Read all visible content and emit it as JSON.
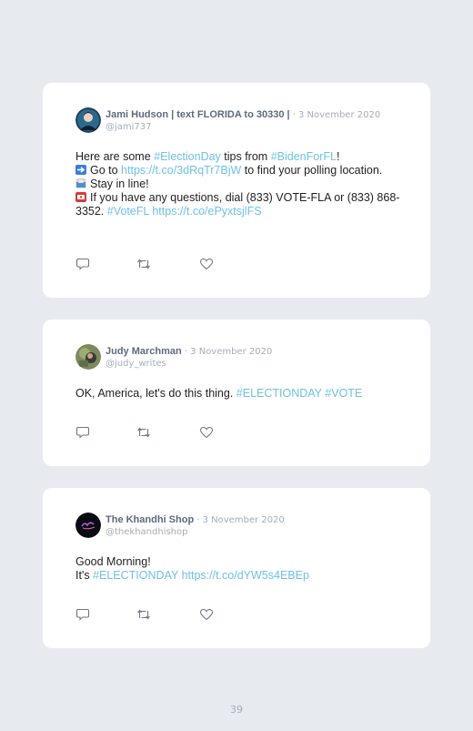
{
  "tweets": [
    {
      "name": "Jami Hudson | text FLORIDA to 30330 |",
      "meta": "· 3 November 2020",
      "handle": "@jami737",
      "lines": {
        "l1a": "Here are some ",
        "l1tag": "#ElectionDay",
        "l1b": " tips from ",
        "l1tag2": "#BidenForFL",
        "l1c": "!",
        "l2a": "Go to ",
        "l2link": "https://t.co/3dRqTr7BjW",
        "l2b": " to find your polling location.",
        "l3": "Stay in line!",
        "l4": "If you have any questions, dial (833) VOTE-FLA or (833) 868-3352. ",
        "l4tag": "#VoteFL",
        "l4link": "https://t.co/ePyxtsjlFS"
      }
    },
    {
      "name": "Judy Marchman",
      "meta": "· 3 November 2020",
      "handle": "@judy_writes",
      "lines": {
        "l1": "OK, America, let's do this thing. ",
        "tag1": "#ELECTIONDAY",
        "tag2": "#VOTE"
      }
    },
    {
      "name": "The Khandhi Shop",
      "meta": "· 3 November 2020",
      "handle": "@thekhandhishop",
      "lines": {
        "l1": "Good Morning!",
        "l2a": "It's ",
        "l2tag": "#ELECTIONDAY",
        "l2link": "https://t.co/dYW5s4EBEp"
      }
    }
  ],
  "icons": [
    "reply-icon",
    "retweet-icon",
    "like-icon"
  ],
  "page_number": "39",
  "colors": {
    "background": "#e7ebf0",
    "card": "#ffffff",
    "link": "#6ec1e4",
    "name": "#5b6b7d",
    "meta": "#a3adb8"
  }
}
